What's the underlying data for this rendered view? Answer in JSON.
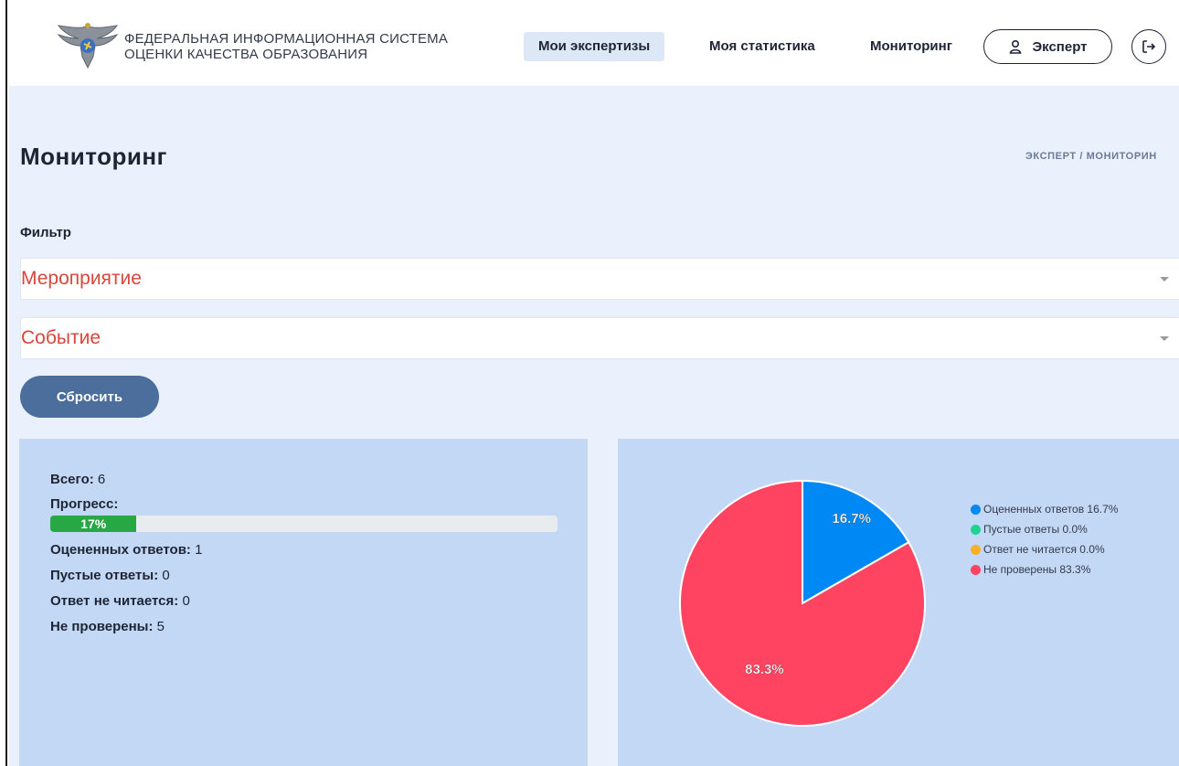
{
  "header": {
    "brand_line1": "ФЕДЕРАЛЬНАЯ ИНФОРМАЦИОННАЯ СИСТЕМА",
    "brand_line2": "ОЦЕНКИ КАЧЕСТВА ОБРАЗОВАНИЯ",
    "nav": [
      {
        "label": "Мои экспертизы",
        "active": true
      },
      {
        "label": "Моя статистика",
        "active": false
      },
      {
        "label": "Мониторинг",
        "active": false
      }
    ],
    "user_label": "Эксперт",
    "user_icon": "user-icon",
    "logout_icon": "logout-icon"
  },
  "page": {
    "title": "Мониторинг",
    "breadcrumb": "ЭКСПЕРТ / МОНИТОРИН"
  },
  "filter": {
    "label": "Фильтр",
    "event_placeholder": "Мероприятие",
    "session_placeholder": "Событие",
    "reset_label": "Сбросить"
  },
  "stats": {
    "total_label": "Всего:",
    "total_value": "6",
    "progress_label": "Прогресс:",
    "progress_text": "17%",
    "progress_fraction": 0.17,
    "rated_label": "Оцененных ответов:",
    "rated_value": "1",
    "empty_label": "Пустые ответы:",
    "empty_value": "0",
    "unreadable_label": "Ответ не читается:",
    "unreadable_value": "0",
    "unchecked_label": "Не проверены:",
    "unchecked_value": "5"
  },
  "chart_data": {
    "type": "pie",
    "slices": [
      {
        "label": "Оцененных ответов",
        "value": 16.7,
        "color": "#0088f5",
        "data_label": "16.7%",
        "legend": "Оцененных ответов 16.7%"
      },
      {
        "label": "Пустые ответы",
        "value": 0.0,
        "color": "#1ed391",
        "data_label": "",
        "legend": "Пустые ответы 0.0%"
      },
      {
        "label": "Ответ не читается",
        "value": 0.0,
        "color": "#fbaf24",
        "data_label": "",
        "legend": "Ответ не читается 0.0%"
      },
      {
        "label": "Не проверены",
        "value": 83.3,
        "color": "#fe4460",
        "data_label": "83.3%",
        "legend": "Не проверены 83.3%"
      }
    ],
    "legend_position": "right"
  },
  "colors": {
    "accent_reset": "#4b6e9c",
    "progress": "#28a745",
    "placeholder": "#d9463b",
    "panel": "#c3d8f5",
    "page_bg": "#eaf1fc"
  }
}
